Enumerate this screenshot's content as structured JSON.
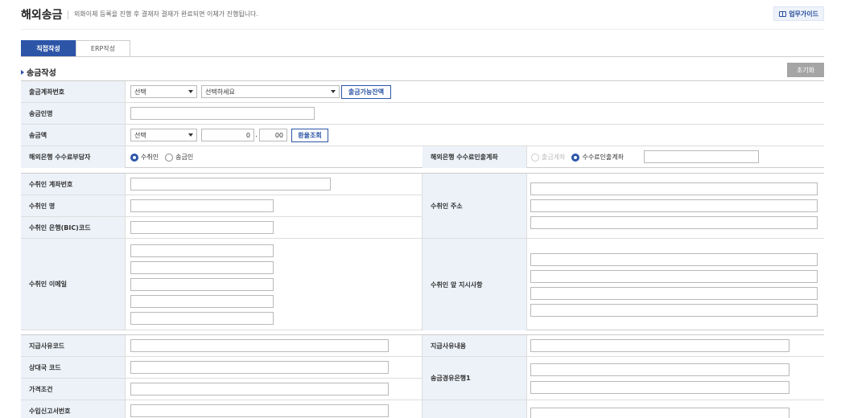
{
  "header": {
    "title": "해외송금",
    "description": "외화이체 등록을 진행 후 결재자 결재가 완료되면 이체가 진행됩니다.",
    "guide_label": "업무가이드"
  },
  "tabs": [
    {
      "label": "직접작성",
      "active": true
    },
    {
      "label": "ERP작성",
      "active": false
    }
  ],
  "section": {
    "title": "송금작성",
    "reset_label": "초기화"
  },
  "form": {
    "withdraw_account": {
      "label": "출금계좌번호",
      "select1": "선택",
      "select2": "선택하세요",
      "balance_button": "출금가능잔액"
    },
    "sender_name": {
      "label": "송금인명",
      "value": ""
    },
    "amount": {
      "label": "송금액",
      "currency": "선택",
      "integer": "0",
      "separator": ".",
      "decimal": "00",
      "rate_button": "환율조회"
    },
    "fee_payer": {
      "label": "해외은행 수수료부담자",
      "options": [
        "수취인",
        "송금인"
      ],
      "selected": "수취인"
    },
    "fee_account": {
      "label": "해외은행 수수료인출계좌",
      "options": [
        "출금계좌",
        "수수료인출계좌"
      ],
      "selected": "수수료인출계좌",
      "disabled_option": "출금계좌",
      "value": ""
    },
    "recipient": {
      "account_label": "수취인 계좌번호",
      "name_label": "수취인 명",
      "bank_label": "수취인 은행(BIC)코드",
      "address_label": "수취인 주소",
      "email_label": "수취인 이메일",
      "instruction_label": "수취인 앞 지시사항"
    },
    "payment": {
      "reason_code_label": "지급사유코드",
      "reason_content_label": "지급사유내용",
      "country_code_label": "상대국 코드",
      "via_bank_label": "송금경유은행1",
      "price_terms_label": "가격조건",
      "import_report_label": "수입신고서번호"
    }
  },
  "colors": {
    "accent": "#2c55a8",
    "label_bg": "#edf2f9",
    "reset_bg": "#a5a5a5"
  }
}
